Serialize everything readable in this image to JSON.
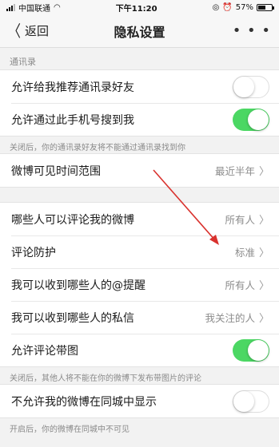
{
  "status_bar": {
    "carrier": "中国联通",
    "time": "下午11:20",
    "battery": "57%",
    "battery_level": 0.57
  },
  "nav": {
    "back_label": "返回",
    "title": "隐私设置",
    "more": "• • •"
  },
  "contacts_section": {
    "label": "通讯录",
    "rows": [
      {
        "label": "允许给我推荐通讯录好友",
        "toggle": "off"
      },
      {
        "label": "允许通过此手机号搜到我",
        "toggle": "on"
      }
    ],
    "note": "关闭后，你的通讯录好友将不能通过通讯录找到你"
  },
  "visibility": {
    "label": "微博可见时间范围",
    "value": "最近半年"
  },
  "comments_group": [
    {
      "label": "哪些人可以评论我的微博",
      "value": "所有人"
    },
    {
      "label": "评论防护",
      "value": "标准"
    },
    {
      "label": "我可以收到哪些人的@提醒",
      "value": "所有人"
    },
    {
      "label": "我可以收到哪些人的私信",
      "value": "我关注的人"
    },
    {
      "label": "允许评论带图",
      "toggle": "on"
    }
  ],
  "comments_note": "关闭后，其他人将不能在你的微博下发布带图片的评论",
  "city": {
    "label": "不允许我的微博在同城中显示",
    "toggle": "off"
  },
  "city_note": "开启后，你的微博在同城中不可见",
  "colors": {
    "toggle_on": "#4bd763",
    "annotation_arrow": "#d9322e"
  }
}
